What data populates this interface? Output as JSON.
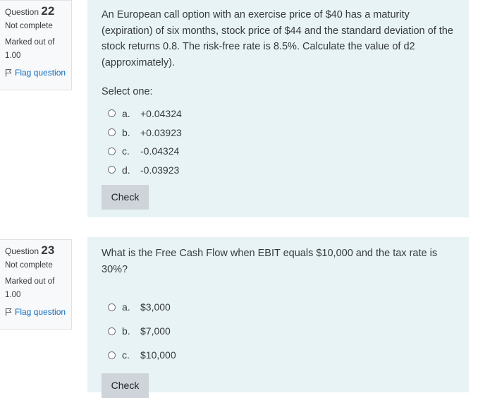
{
  "questions": [
    {
      "label": "Question",
      "number": "22",
      "state": "Not complete",
      "grade_line1": "Marked out of",
      "grade_line2": "1.00",
      "flag_label": "Flag question",
      "text": "An European call option with an exercise price of $40 has a maturity (expiration) of six months, stock price of $44 and the standard deviation of the stock returns 0.8. The risk-free rate is 8.5%. Calculate the value of d2 (approximately).",
      "prompt": "Select one:",
      "options": [
        {
          "letter": "a.",
          "value": "+0.04324"
        },
        {
          "letter": "b.",
          "value": "+0.03923"
        },
        {
          "letter": "c.",
          "value": "-0.04324"
        },
        {
          "letter": "d.",
          "value": "-0.03923"
        }
      ],
      "check_label": "Check"
    },
    {
      "label": "Question",
      "number": "23",
      "state": "Not complete",
      "grade_line1": "Marked out of",
      "grade_line2": "1.00",
      "flag_label": "Flag question",
      "text": "What is the Free Cash Flow when EBIT equals $10,000 and the tax rate is 30%?",
      "options": [
        {
          "letter": "a.",
          "value": "$3,000"
        },
        {
          "letter": "b.",
          "value": "$7,000"
        },
        {
          "letter": "c.",
          "value": "$10,000"
        }
      ],
      "check_label": "Check"
    }
  ],
  "colors": {
    "content_bg": "#e7f3f5",
    "info_bg": "#f8f9fa",
    "link": "#0f6cbf",
    "button_bg": "#ced4da"
  }
}
